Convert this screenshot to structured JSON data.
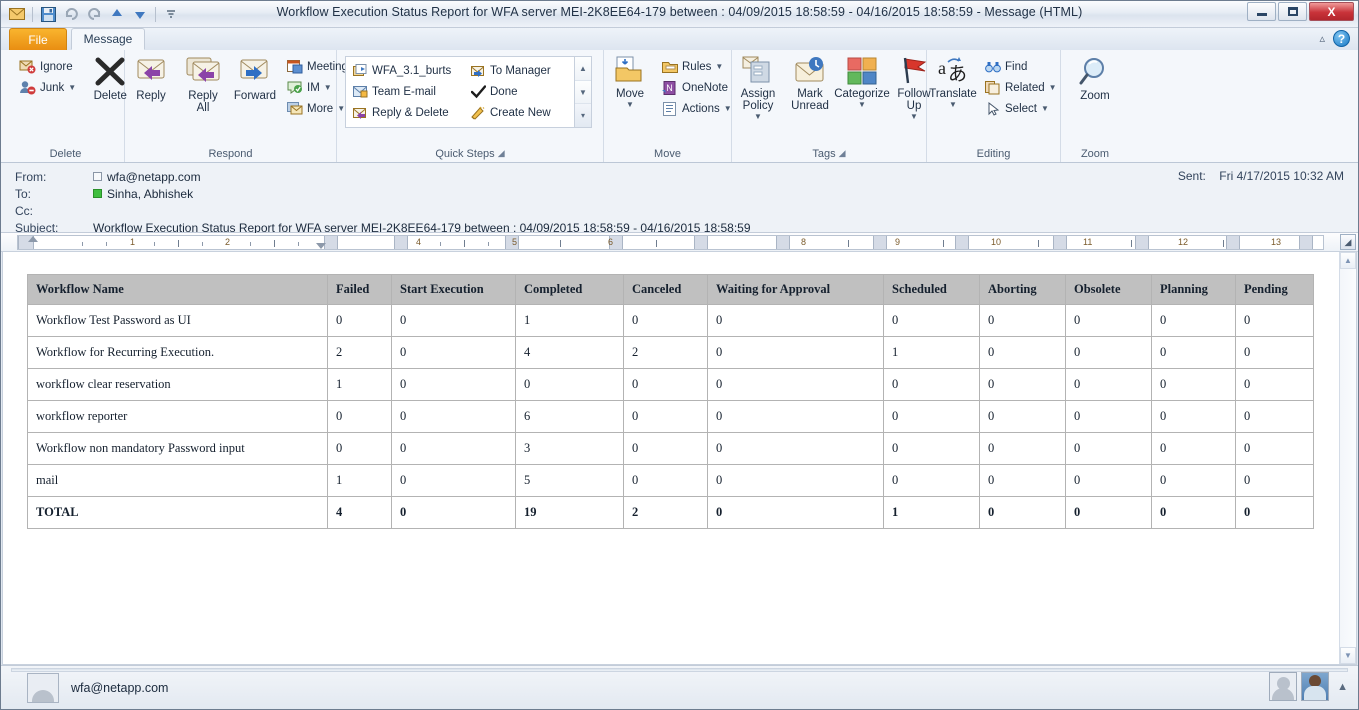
{
  "window": {
    "title": "Workflow Execution Status Report for WFA server MEI-2K8EE64-179 between : 04/09/2015 18:58:59 - 04/16/2015 18:58:59  -  Message (HTML)",
    "minimize_label": "Minimize",
    "maximize_label": "Restore",
    "close_label": "X"
  },
  "quick_access": {
    "envelope_icon": "envelope-icon",
    "save_icon": "save-icon",
    "undo_icon": "undo-icon",
    "redo_icon": "redo-icon",
    "previous_icon": "previous-item-icon",
    "next_icon": "next-item-icon",
    "customize_icon": "customize-qat-icon"
  },
  "tabs": [
    {
      "label": "File",
      "name": "tab-file"
    },
    {
      "label": "Message",
      "name": "tab-message"
    }
  ],
  "help": {
    "collapse_icon": "collapse-ribbon-icon",
    "help_icon": "help-icon"
  },
  "ribbon": {
    "groups": [
      {
        "label": "Delete",
        "small_buttons": [
          {
            "label": "Ignore",
            "icon": "ignore-icon"
          },
          {
            "label": "Junk",
            "icon": "junk-icon",
            "dropdown": true
          }
        ],
        "big_buttons": [
          {
            "label": "Delete",
            "icon": "delete-x-icon"
          }
        ]
      },
      {
        "label": "Respond",
        "big_buttons": [
          {
            "label": "Reply",
            "icon": "reply-icon"
          },
          {
            "label": "Reply All",
            "icon": "reply-all-icon"
          },
          {
            "label": "Forward",
            "icon": "forward-icon"
          }
        ],
        "small_buttons": [
          {
            "label": "Meeting",
            "icon": "meeting-icon"
          },
          {
            "label": "IM",
            "icon": "im-icon",
            "dropdown": true
          },
          {
            "label": "More",
            "icon": "more-icon",
            "dropdown": true
          }
        ]
      },
      {
        "label": "Quick Steps",
        "quick_steps": [
          {
            "label": "WFA_3.1_burts",
            "icon": "quickstep-move-icon"
          },
          {
            "label": "To Manager",
            "icon": "quickstep-forward-icon"
          },
          {
            "label": "Team E-mail",
            "icon": "quickstep-teamemail-icon"
          },
          {
            "label": "Done",
            "icon": "check-icon"
          },
          {
            "label": "Reply & Delete",
            "icon": "quickstep-replydelete-icon"
          },
          {
            "label": "Create New",
            "icon": "quickstep-createnew-icon"
          }
        ],
        "dialog_launcher": "dialog-launcher-icon"
      },
      {
        "label": "Move",
        "big_buttons": [
          {
            "label": "Move",
            "icon": "move-icon",
            "dropdown": true
          }
        ],
        "small_buttons": [
          {
            "label": "Rules",
            "icon": "rules-icon",
            "dropdown": true
          },
          {
            "label": "OneNote",
            "icon": "onenote-icon"
          },
          {
            "label": "Actions",
            "icon": "actions-icon",
            "dropdown": true
          }
        ]
      },
      {
        "label": "Tags",
        "big_buttons": [
          {
            "label": "Assign Policy",
            "icon": "assign-policy-icon",
            "dropdown": true
          },
          {
            "label": "Mark Unread",
            "icon": "mark-unread-icon"
          },
          {
            "label": "Categorize",
            "icon": "categorize-icon",
            "dropdown": true
          },
          {
            "label": "Follow Up",
            "icon": "follow-up-flag-icon",
            "dropdown": true
          }
        ],
        "dialog_launcher": "dialog-launcher-icon"
      },
      {
        "label": "Editing",
        "big_buttons": [
          {
            "label": "Translate",
            "icon": "translate-icon",
            "dropdown": true
          }
        ],
        "small_buttons": [
          {
            "label": "Find",
            "icon": "find-binoculars-icon"
          },
          {
            "label": "Related",
            "icon": "related-icon",
            "dropdown": true
          },
          {
            "label": "Select",
            "icon": "select-pointer-icon",
            "dropdown": true
          }
        ]
      },
      {
        "label": "Zoom",
        "big_buttons": [
          {
            "label": "Zoom",
            "icon": "zoom-magnifier-icon"
          }
        ]
      }
    ]
  },
  "message_header": {
    "from_label": "From:",
    "from_value": "wfa@netapp.com",
    "to_label": "To:",
    "to_value": "Sinha, Abhishek",
    "cc_label": "Cc:",
    "cc_value": "",
    "subject_label": "Subject:",
    "subject_value": "Workflow Execution Status Report for WFA server MEI-2K8EE64-179 between : 04/09/2015 18:58:59 - 04/16/2015 18:58:59",
    "sent_label": "Sent:",
    "sent_value": "Fri 4/17/2015 10:32 AM"
  },
  "ruler": {
    "numbers": [
      "1",
      "2",
      "4",
      "5",
      "6",
      "8",
      "9",
      "10",
      "11",
      "12",
      "13"
    ]
  },
  "chart_data": {
    "type": "table",
    "title": "Workflow Execution Status Report",
    "columns": [
      "Workflow Name",
      "Failed",
      "Start Execution",
      "Completed",
      "Canceled",
      "Waiting for Approval",
      "Scheduled",
      "Aborting",
      "Obsolete",
      "Planning",
      "Pending"
    ],
    "rows": [
      {
        "cells": [
          "Workflow Test Password as UI",
          "0",
          "0",
          "1",
          "0",
          "0",
          "0",
          "0",
          "0",
          "0",
          "0"
        ]
      },
      {
        "cells": [
          "Workflow for Recurring Execution.",
          "2",
          "0",
          "4",
          "2",
          "0",
          "1",
          "0",
          "0",
          "0",
          "0"
        ]
      },
      {
        "cells": [
          "workflow clear reservation",
          "1",
          "0",
          "0",
          "0",
          "0",
          "0",
          "0",
          "0",
          "0",
          "0"
        ]
      },
      {
        "cells": [
          "workflow reporter",
          "0",
          "0",
          "6",
          "0",
          "0",
          "0",
          "0",
          "0",
          "0",
          "0"
        ]
      },
      {
        "cells": [
          "Workflow non mandatory Password input",
          "0",
          "0",
          "3",
          "0",
          "0",
          "0",
          "0",
          "0",
          "0",
          "0"
        ]
      },
      {
        "cells": [
          "mail",
          "1",
          "0",
          "5",
          "0",
          "0",
          "0",
          "0",
          "0",
          "0",
          "0"
        ]
      }
    ],
    "total_row": {
      "cells": [
        "TOTAL",
        "4",
        "0",
        "19",
        "2",
        "0",
        "1",
        "0",
        "0",
        "0",
        "0"
      ]
    }
  },
  "status_bar": {
    "email": "wfa@netapp.com",
    "sender_avatar": "sender-avatar",
    "recipient_avatar": "recipient-avatar-photo",
    "expand_icon": "expand-people-pane-icon"
  },
  "scrollbar": {
    "up_icon": "scroll-up-icon",
    "down_icon": "scroll-down-icon"
  }
}
